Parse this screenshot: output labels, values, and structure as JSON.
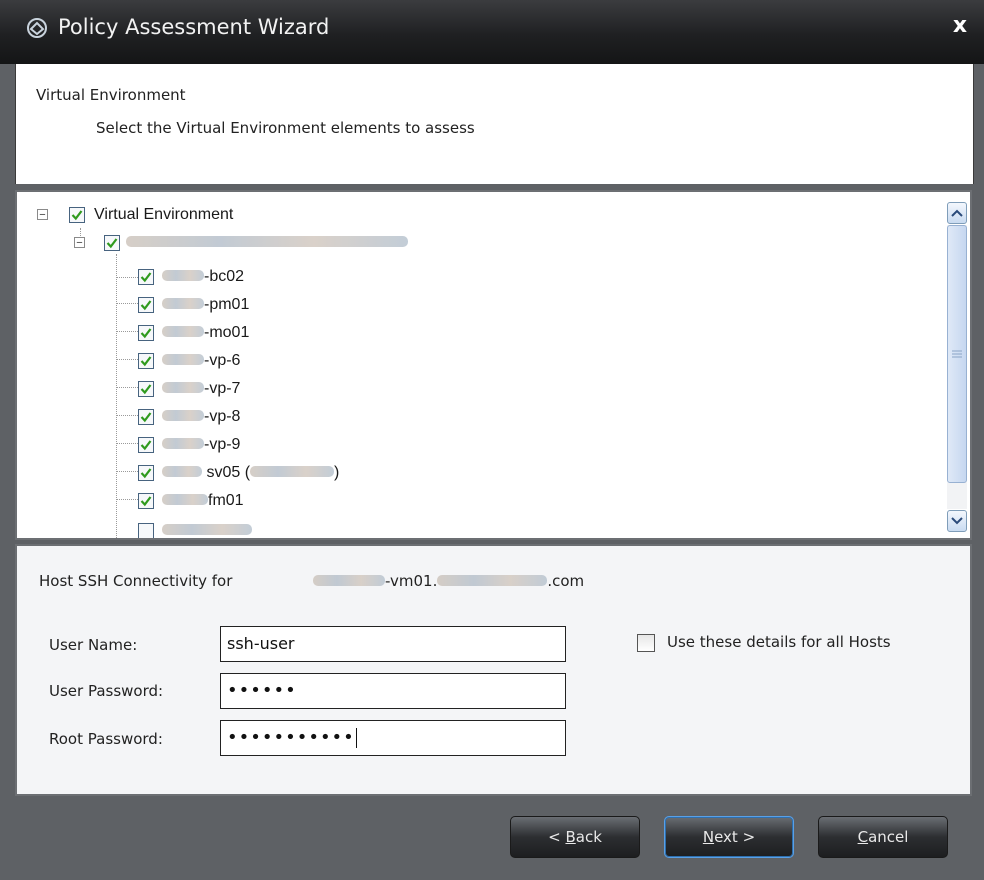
{
  "window": {
    "title": "Policy Assessment Wizard",
    "close_label": "x"
  },
  "header": {
    "title": "Virtual Environment",
    "subtitle": "Select the Virtual Environment elements to assess"
  },
  "tree": {
    "root": {
      "label": "Virtual Environment",
      "checked": true,
      "expanded": true
    },
    "host": {
      "label": "",
      "checked": true,
      "expanded": true
    },
    "items": [
      {
        "suffix": "-bc02",
        "checked": true
      },
      {
        "suffix": "-pm01",
        "checked": true
      },
      {
        "suffix": "-mo01",
        "checked": true
      },
      {
        "suffix": "-vp-6",
        "checked": true
      },
      {
        "suffix": "-vp-7",
        "checked": true
      },
      {
        "suffix": "-vp-8",
        "checked": true
      },
      {
        "suffix": "-vp-9",
        "checked": true
      },
      {
        "suffix": "sv05 (",
        "checked": true,
        "tail": ")"
      },
      {
        "suffix": "fm01",
        "checked": true
      }
    ]
  },
  "ssh": {
    "title": "Host SSH Connectivity for",
    "host_prefix": "-vm01.",
    "host_suffix": ".com",
    "user_name_label": "User Name:",
    "user_name_value": "ssh-user",
    "user_password_label": "User Password:",
    "user_password_value": "••••••",
    "root_password_label": "Root Password:",
    "root_password_value": "•••••••••••",
    "all_hosts_label": "Use these details for all Hosts",
    "all_hosts_checked": false
  },
  "footer": {
    "back_pre": "< ",
    "back_u": "B",
    "back_post": "ack",
    "next_u": "N",
    "next_post": "ext >",
    "cancel_u": "C",
    "cancel_post": "ancel"
  },
  "colors": {
    "checkmark": "#2f9a1e",
    "titlebar": "#1f2022",
    "window_bg": "#5e6165"
  }
}
